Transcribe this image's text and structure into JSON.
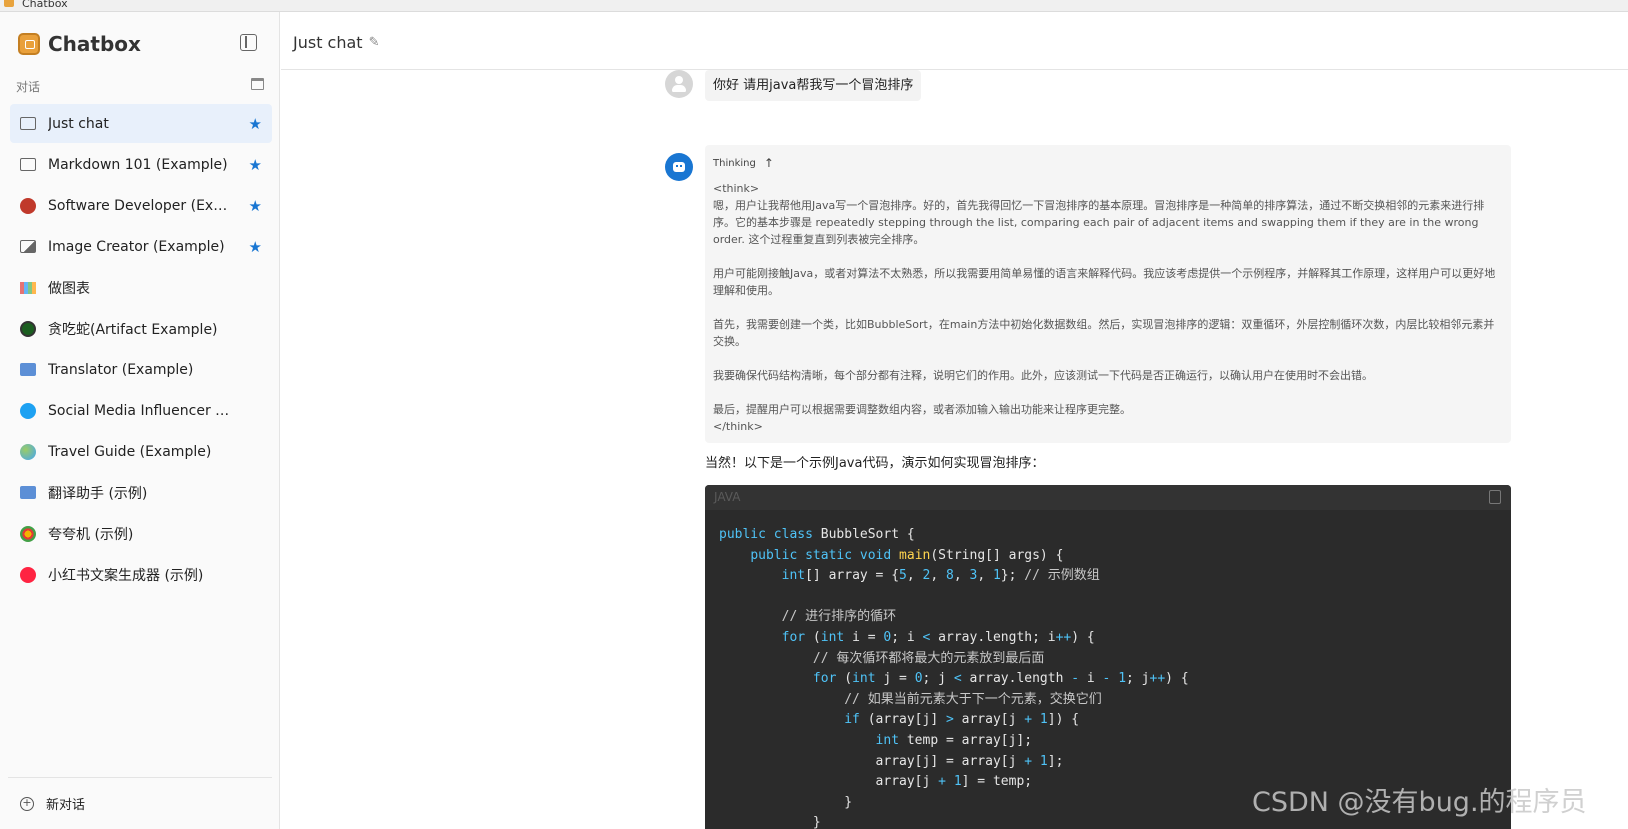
{
  "window": {
    "title": "Chatbox"
  },
  "brand": {
    "name": "Chatbox"
  },
  "sidebar": {
    "section_label": "对话",
    "items": [
      {
        "label": "Just chat",
        "icon": "chat-icon",
        "starred": true,
        "active": true
      },
      {
        "label": "Markdown 101 (Example)",
        "icon": "chat-icon",
        "starred": true
      },
      {
        "label": "Software Developer (Example)",
        "icon": "developer-avatar-icon",
        "starred": true
      },
      {
        "label": "Image Creator (Example)",
        "icon": "image-icon",
        "starred": true
      },
      {
        "label": "做图表",
        "icon": "chart-avatar-icon",
        "starred": false
      },
      {
        "label": "贪吃蛇(Artifact Example)",
        "icon": "snake-avatar-icon",
        "starred": false
      },
      {
        "label": "Translator (Example)",
        "icon": "translator-avatar-icon",
        "starred": false
      },
      {
        "label": "Social Media Influencer (Example)",
        "icon": "twitter-avatar-icon",
        "starred": false
      },
      {
        "label": "Travel Guide (Example)",
        "icon": "globe-avatar-icon",
        "starred": false
      },
      {
        "label": "翻译助手 (示例)",
        "icon": "translator-avatar-icon",
        "starred": false
      },
      {
        "label": "夸夸机 (示例)",
        "icon": "praise-avatar-icon",
        "starred": false
      },
      {
        "label": "小红书文案生成器 (示例)",
        "icon": "xiaohongshu-avatar-icon",
        "starred": false
      }
    ],
    "new_chat_label": "新对话"
  },
  "header": {
    "title": "Just chat"
  },
  "messages": {
    "user_text": "你好 请用java帮我写一个冒泡排序",
    "thinking": {
      "label": "Thinking",
      "open_tag": "<think>",
      "paragraphs": [
        "嗯，用户让我帮他用Java写一个冒泡排序。好的，首先我得回忆一下冒泡排序的基本原理。冒泡排序是一种简单的排序算法，通过不断交换相邻的元素来进行排序。它的基本步骤是 repeatedly stepping through the list, comparing each pair of adjacent items and swapping them if they are in the wrong order. 这个过程重复直到列表被完全排序。",
        "用户可能刚接触Java，或者对算法不太熟悉，所以我需要用简单易懂的语言来解释代码。我应该考虑提供一个示例程序，并解释其工作原理，这样用户可以更好地理解和使用。",
        "首先，我需要创建一个类，比如BubbleSort，在main方法中初始化数据数组。然后，实现冒泡排序的逻辑：双重循环，外层控制循环次数，内层比较相邻元素并交换。",
        "我要确保代码结构清晰，每个部分都有注释，说明它们的作用。此外，应该测试一下代码是否正确运行，以确认用户在使用时不会出错。",
        "最后，提醒用户可以根据需要调整数组内容，或者添加输入输出功能来让程序更完整。"
      ],
      "close_tag": "</think>"
    },
    "answer_intro": "当然！以下是一个示例Java代码，演示如何实现冒泡排序：",
    "code": {
      "language": "JAVA",
      "lines": {
        "l1_a": "public",
        "l1_b": "class",
        "l1_c": "BubbleSort {",
        "l2_a": "public",
        "l2_b": "static",
        "l2_c": "void",
        "l2_fn": "main",
        "l2_d": "(String[] args) {",
        "l3_a": "int",
        "l3_b": "[] array = {",
        "l3_n1": "5",
        "l3_n2": "2",
        "l3_n3": "8",
        "l3_n4": "3",
        "l3_n5": "1",
        "l3_c": "}; ",
        "l3_cm": "// 示例数组",
        "l5_cm": "// 进行排序的循环",
        "l6_kw": "for",
        "l6_a": " (",
        "l6_int": "int",
        "l6_b": " i = ",
        "l6_n": "0",
        "l6_c": "; i ",
        "l6_op": "<",
        "l6_d": " array.length; i",
        "l6_pp": "++",
        "l6_e": ") {",
        "l7_cm": "// 每次循环都将最大的元素放到最后面",
        "l8_kw": "for",
        "l8_a": " (",
        "l8_int": "int",
        "l8_b": " j = ",
        "l8_n": "0",
        "l8_c": "; j ",
        "l8_op": "<",
        "l8_d": " array.length ",
        "l8_m1": "-",
        "l8_e": " i ",
        "l8_m2": "-",
        "l8_n2": "1",
        "l8_f": "; j",
        "l8_pp": "++",
        "l8_g": ") {",
        "l9_cm": "// 如果当前元素大于下一个元素，交换它们",
        "l10_kw": "if",
        "l10_a": " (array[j] ",
        "l10_op": ">",
        "l10_b": " array[j ",
        "l10_plus": "+",
        "l10_n": "1",
        "l10_c": "]) {",
        "l11_int": "int",
        "l11_a": " temp = array[j];",
        "l12_a": "array[j] = array[j ",
        "l12_plus": "+",
        "l12_n": "1",
        "l12_b": "];",
        "l13_a": "array[j ",
        "l13_plus": "+",
        "l13_n": "1",
        "l13_b": "] = temp;",
        "l14_a": "}",
        "l15_a": "}"
      }
    }
  },
  "watermark": "CSDN @没有bug.的程序员",
  "colors": {
    "accent": "#1976d2",
    "code_bg": "#2b2b2b",
    "keyword": "#4fc3f7",
    "function": "#ffd54f"
  }
}
